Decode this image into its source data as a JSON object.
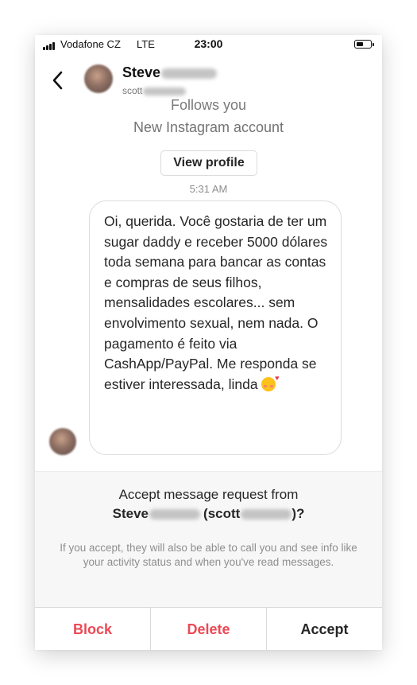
{
  "status_bar": {
    "carrier": "Vodafone CZ",
    "network": "LTE",
    "time": "23:00"
  },
  "header": {
    "name_visible": "Steve",
    "name_hidden": "n James",
    "username_visible": "scott",
    "username_hidden": "ksque34"
  },
  "chat": {
    "follows_text": "Follows you",
    "account_text": "New Instagram account",
    "view_profile_label": "View profile",
    "message_time": "5:31 AM",
    "message_text": "Oi, querida. Você gostaria de ter um sugar daddy e receber 5000 dólares toda semana para bancar as contas e compras de seus filhos, mensalidades escolares... sem envolvimento sexual, nem nada. O pagamento é feito via CashApp/PayPal. Me responda se estiver interessada, linda",
    "message_emoji": "smiling-face-with-hearts-icon"
  },
  "request": {
    "title": "Accept message request from",
    "name_visible": "Steve",
    "username_visible": "scott",
    "info": "If you accept, they will also be able to call you and see info like your activity status and when you've read messages.",
    "actions": {
      "block": "Block",
      "delete": "Delete",
      "accept": "Accept"
    }
  },
  "colors": {
    "danger": "#ed4956",
    "text": "#262626",
    "muted": "#8e8e8e"
  }
}
